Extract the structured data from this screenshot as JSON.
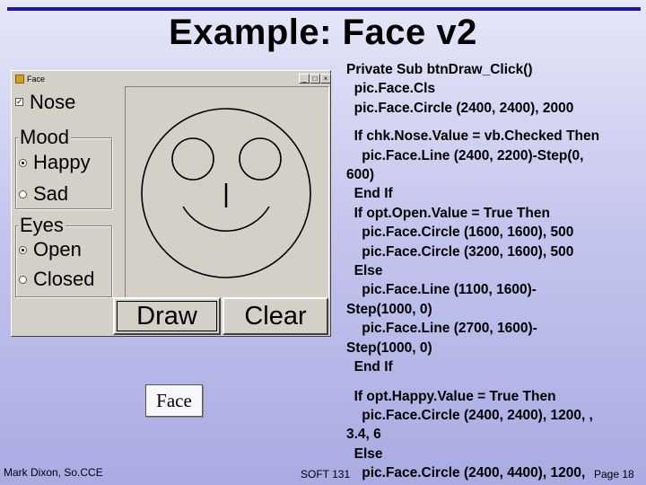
{
  "slide": {
    "title": "Example: Face v2"
  },
  "window": {
    "title": "Face",
    "minimize_glyph": "_",
    "maximize_glyph": "□",
    "close_glyph": "×"
  },
  "controls": {
    "nose": {
      "label": "Nose",
      "checked": true
    },
    "mood": {
      "caption": "Mood",
      "options": [
        {
          "label": "Happy",
          "selected": true
        },
        {
          "label": "Sad",
          "selected": false
        }
      ]
    },
    "eyes": {
      "caption": "Eyes",
      "options": [
        {
          "label": "Open",
          "selected": true
        },
        {
          "label": "Closed",
          "selected": false
        }
      ]
    },
    "draw_label": "Draw",
    "clear_label": "Clear"
  },
  "face_label": "Face",
  "code": [
    "Private Sub btnDraw_Click()",
    "  pic.Face.Cls",
    "  pic.Face.Circle (2400, 2400), 2000",
    "",
    "  If chk.Nose.Value = vb.Checked Then",
    "    pic.Face.Line (2400, 2200)-Step(0,",
    "600)",
    "  End If",
    "  If opt.Open.Value = True Then",
    "    pic.Face.Circle (1600, 1600), 500",
    "    pic.Face.Circle (3200, 1600), 500",
    "  Else",
    "    pic.Face.Line (1100, 1600)-",
    "Step(1000, 0)",
    "    pic.Face.Line (2700, 1600)-",
    "Step(1000, 0)",
    "  End If",
    "  If opt.Happy.Value = True Then",
    "    pic.Face.Circle (2400, 2400), 1200, ,",
    "3.4, 6",
    "  Else",
    "    pic.Face.Circle (2400, 4400), 1200,"
  ],
  "footer": {
    "author": "Mark Dixon, So.CCE",
    "course": "SOFT 131",
    "page": "Page 18"
  },
  "colors": {
    "title_rule": "#1a1aa0",
    "window_face": "#d4d0c8"
  }
}
